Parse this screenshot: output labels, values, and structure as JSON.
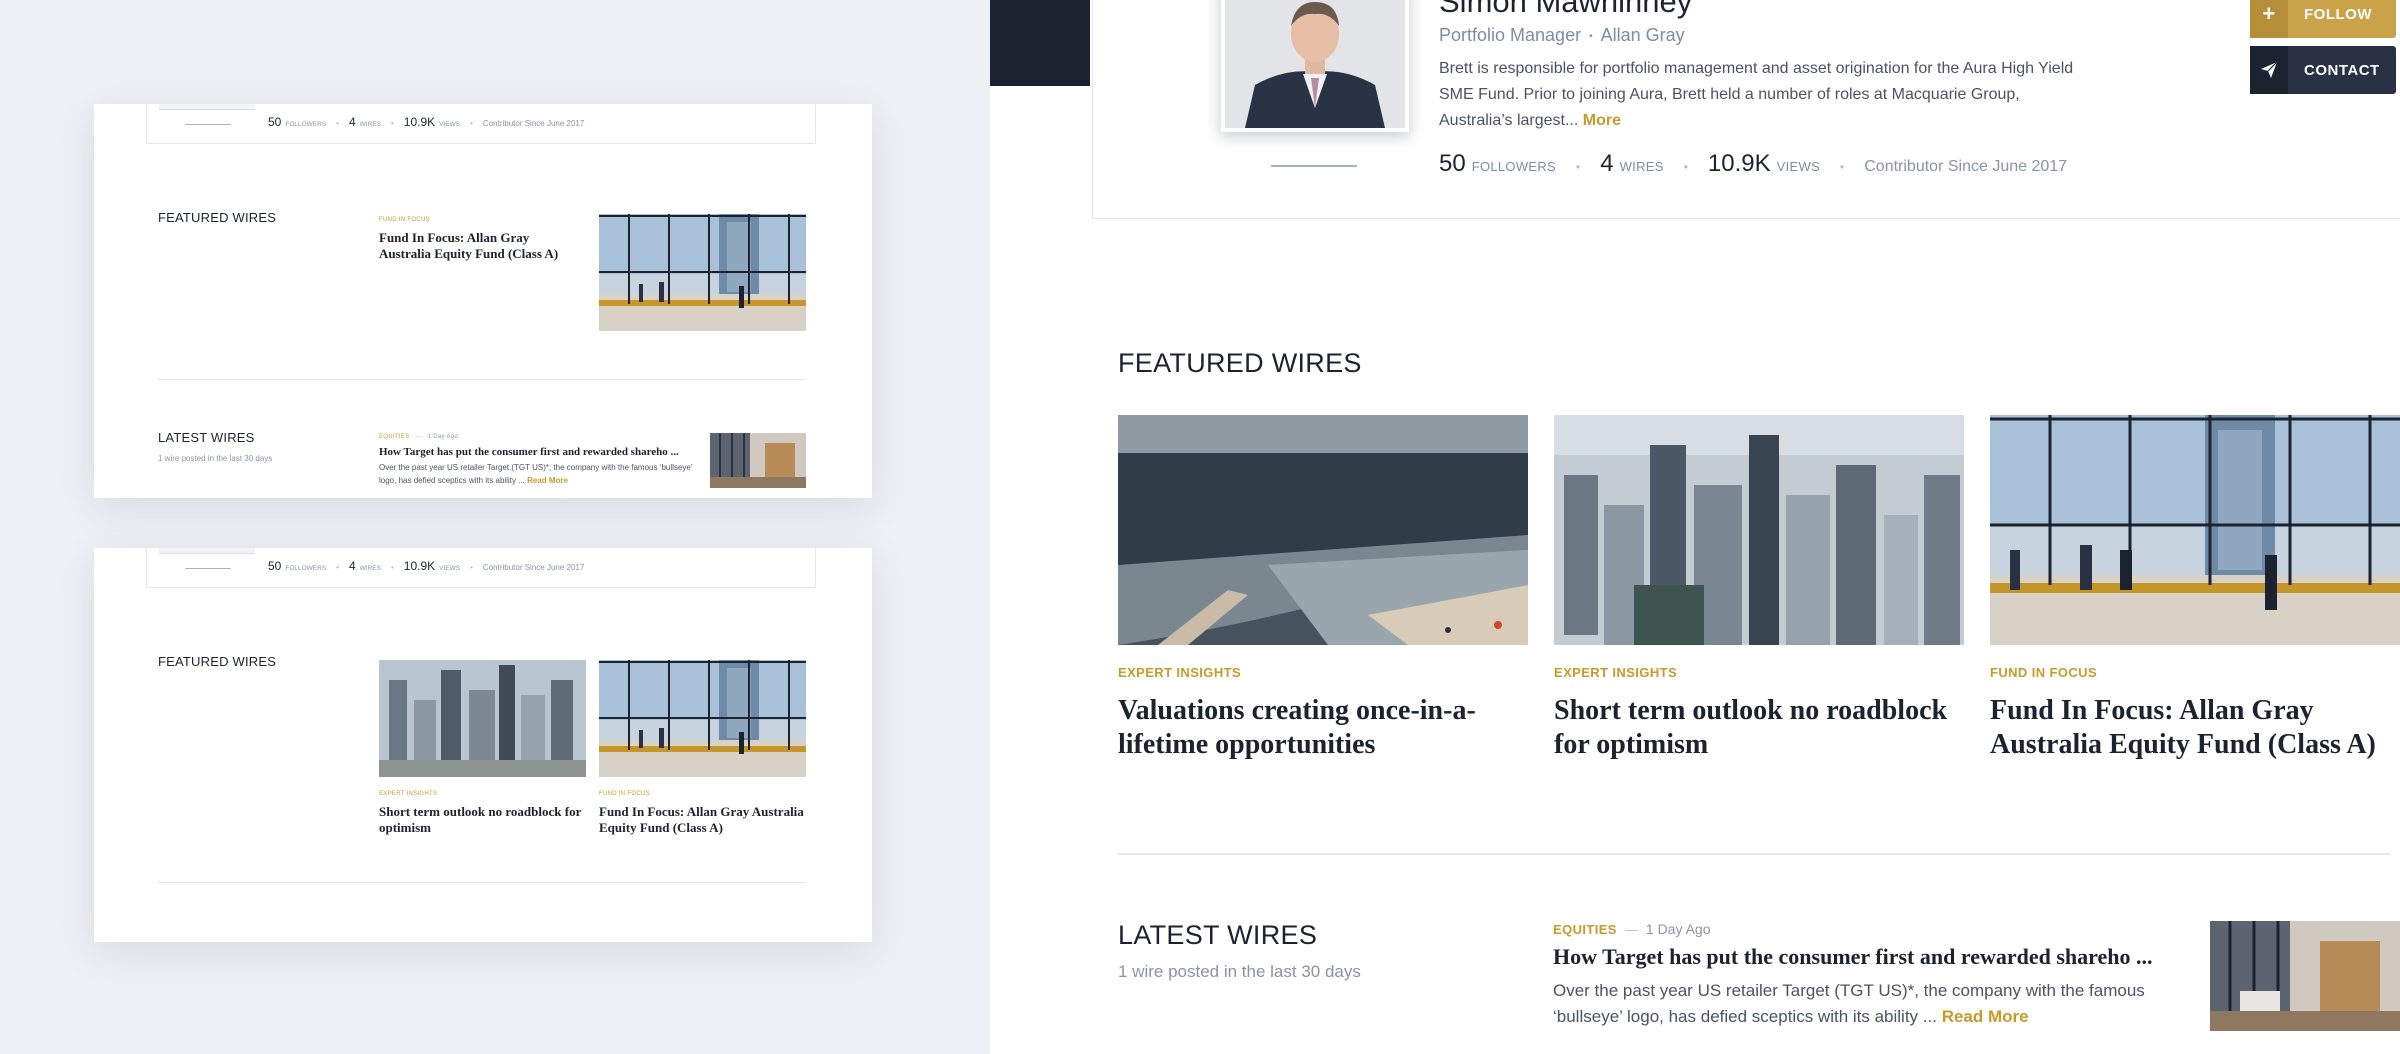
{
  "profile": {
    "name": "Simon Mawhinney",
    "role": "Portfolio Manager",
    "company": "Allan Gray",
    "bio": "Brett is responsible for portfolio management and asset origination for the Aura High Yield SME Fund. Prior to joining Aura, Brett held a number of roles at Macquarie Group, Australia’s largest...",
    "bio_more": "More",
    "followers_value": "50",
    "followers_label": "FOLLOWERS",
    "wires_value": "4",
    "wires_label": "WIRES",
    "views_value": "10.9K",
    "views_label": "VIEWS",
    "contributor_since": "Contributor Since June 2017"
  },
  "actions": {
    "follow_label": "FOLLOW",
    "follow_icon": "plus-icon",
    "contact_label": "CONTACT",
    "contact_icon": "paper-plane-icon"
  },
  "featured": {
    "heading": "FEATURED WIRES",
    "cards": [
      {
        "tag": "EXPERT INSIGHTS",
        "title": "Valuations creating once-in-a-lifetime opportunities",
        "image": "ocean-pool"
      },
      {
        "tag": "EXPERT INSIGHTS",
        "title": "Short term outlook no roadblock for optimism",
        "image": "city-aerial"
      },
      {
        "tag": "FUND IN FOCUS",
        "title": "Fund In Focus: Allan Gray Australia Equity Fund (Class A)",
        "image": "office-window"
      }
    ]
  },
  "latest": {
    "heading": "LATEST WIRES",
    "subtitle": "1 wire posted in the last 30 days",
    "item": {
      "category": "EQUITIES",
      "time": "1 Day Ago",
      "title": "How Target has put the consumer first and rewarded shareho ...",
      "excerpt": "Over the past year US retailer Target (TGT US)*, the company with the famous ‘bullseye’ logo, has defied sceptics with its ability ...",
      "read_more": "Read More"
    }
  },
  "preview1": {
    "featured_heading": "FEATURED WIRES",
    "card_tag": "FUND IN FOCUS",
    "card_title": "Fund In Focus: Allan Gray Australia Equity Fund (Class A)",
    "latest_heading": "LATEST WIRES",
    "latest_sub": "1 wire posted in the last 30 days",
    "latest_category": "EQUITIES",
    "latest_time": "1 Day Ago",
    "latest_title": "How Target has put the consumer first and rewarded shareho ...",
    "latest_excerpt": "Over the past year US retailer Target (TGT US)*, the company with the famous ‘bullseye’ logo, has defied sceptics with its ability ...",
    "latest_more": "Read More"
  },
  "preview2": {
    "featured_heading": "FEATURED WIRES",
    "card1_tag": "EXPERT INSIGHTS",
    "card1_title": "Short term outlook no roadblock for optimism",
    "card2_tag": "FUND IN FOCUS",
    "card2_title": "Fund In Focus: Allan Gray Australia Equity Fund (Class A)"
  },
  "colors": {
    "accent_gold": "#c79a2a",
    "dark_navy": "#1c2230",
    "contact_bg": "#2a3145",
    "follow_bg": "#c9a24a"
  }
}
